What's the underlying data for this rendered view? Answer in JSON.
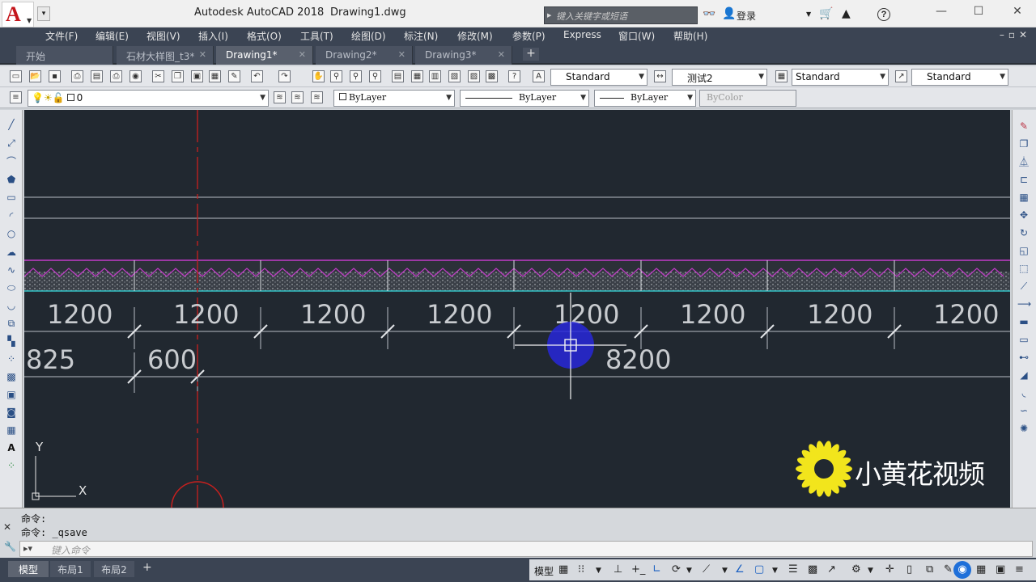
{
  "title": {
    "app": "Autodesk AutoCAD 2018",
    "file": "Drawing1.dwg"
  },
  "search": {
    "placeholder": "键入关键字或短语"
  },
  "account": {
    "login": "登录"
  },
  "menu": [
    "文件(F)",
    "编辑(E)",
    "视图(V)",
    "插入(I)",
    "格式(O)",
    "工具(T)",
    "绘图(D)",
    "标注(N)",
    "修改(M)",
    "参数(P)",
    "Express",
    "窗口(W)",
    "帮助(H)"
  ],
  "tabs": [
    {
      "label": "开始"
    },
    {
      "label": "石材大样图_t3*"
    },
    {
      "label": "Drawing1*",
      "active": true
    },
    {
      "label": "Drawing2*"
    },
    {
      "label": "Drawing3*"
    }
  ],
  "styles": {
    "text_style": "Standard",
    "dim_style": "测试2",
    "table_style": "Standard",
    "mleader_style": "Standard"
  },
  "layer": {
    "current": "0"
  },
  "properties": {
    "color": "ByLayer",
    "linetype": "ByLayer",
    "lineweight": "ByLayer",
    "plotstyle": "ByColor"
  },
  "drawing": {
    "dimensions_top": [
      "1200",
      "1200",
      "1200",
      "1200",
      "1200",
      "1200",
      "1200",
      "1200"
    ],
    "dimension_825": "825",
    "dimension_600": "600",
    "dimension_8200": "8200",
    "ucs_x": "X",
    "ucs_y": "Y"
  },
  "watermark": {
    "text": "小黄花视频"
  },
  "command": {
    "history": [
      "命令:",
      "命令:  _qsave"
    ],
    "placeholder": "键入命令"
  },
  "layouts": [
    {
      "label": "模型",
      "active": true
    },
    {
      "label": "布局1"
    },
    {
      "label": "布局2"
    }
  ],
  "status": {
    "model": "模型"
  },
  "colors": {
    "canvas": "#212830",
    "hatch_magenta": "#c23ac8",
    "cyan_line": "#35c5c9",
    "red_centerline": "#c8201e",
    "cursor_highlight": "#2727d9"
  }
}
